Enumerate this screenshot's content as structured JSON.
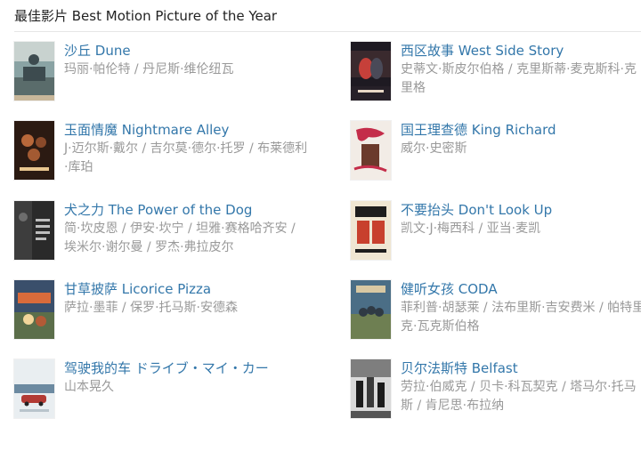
{
  "section": {
    "title": "最佳影片 Best Motion Picture of the Year"
  },
  "films": [
    {
      "name": "沙丘 Dune",
      "cast": "玛丽·帕伦特 / 丹尼斯·维伦纽瓦",
      "poster_colors": [
        "#3d4b4f",
        "#8aa3a4",
        "#c8b79a"
      ]
    },
    {
      "name": "西区故事 West Side Story",
      "cast": "史蒂文·斯皮尔伯格 / 克里斯蒂·麦克斯科·克里格",
      "poster_colors": [
        "#1e1a22",
        "#c6403a",
        "#e7d8c6"
      ]
    },
    {
      "name": "玉面情魔 Nightmare Alley",
      "cast": "J·迈尔斯·戴尔 / 吉尔莫·德尔·托罗 / 布莱德利·库珀",
      "poster_colors": [
        "#2b1a12",
        "#b8683a",
        "#e9c68f"
      ]
    },
    {
      "name": "国王理查德 King Richard",
      "cast": "威尔·史密斯",
      "poster_colors": [
        "#f2ece6",
        "#c42d4a",
        "#6b3a2c"
      ]
    },
    {
      "name": "犬之力 The Power of the Dog",
      "cast": "简·坎皮恩 / 伊安·坎宁 / 坦雅·赛格哈齐安 / 埃米尔·谢尔曼 / 罗杰·弗拉皮尔",
      "poster_colors": [
        "#2a2a2a",
        "#6d6d6d",
        "#bdbdbd"
      ]
    },
    {
      "name": "不要抬头 Don't Look Up",
      "cast": "凯文·J·梅西科 / 亚当·麦凯",
      "poster_colors": [
        "#efe6d2",
        "#c8402d",
        "#1d1d1d"
      ]
    },
    {
      "name": "甘草披萨 Licorice Pizza",
      "cast": "萨拉·墨菲 / 保罗·托马斯·安德森",
      "poster_colors": [
        "#3a4f6b",
        "#d96b3b",
        "#f2d59a"
      ]
    },
    {
      "name": "健听女孩 CODA",
      "cast": "菲利普·胡瑟莱 / 法布里斯·吉安费米 / 帕特里克·瓦克斯伯格",
      "poster_colors": [
        "#4b6e86",
        "#d8c8a3",
        "#6e7f52"
      ]
    },
    {
      "name": "驾驶我的车 ドライブ・マイ・カー",
      "cast": "山本晃久",
      "poster_colors": [
        "#e9eef1",
        "#b23a34",
        "#6c8aa1"
      ]
    },
    {
      "name": "贝尔法斯特 Belfast",
      "cast": "劳拉·伯威克 / 贝卡·科瓦契克 / 塔马尔·托马斯 / 肯尼思·布拉纳",
      "poster_colors": [
        "#1c1c1c",
        "#7e7e7e",
        "#d9d9d9"
      ]
    }
  ]
}
